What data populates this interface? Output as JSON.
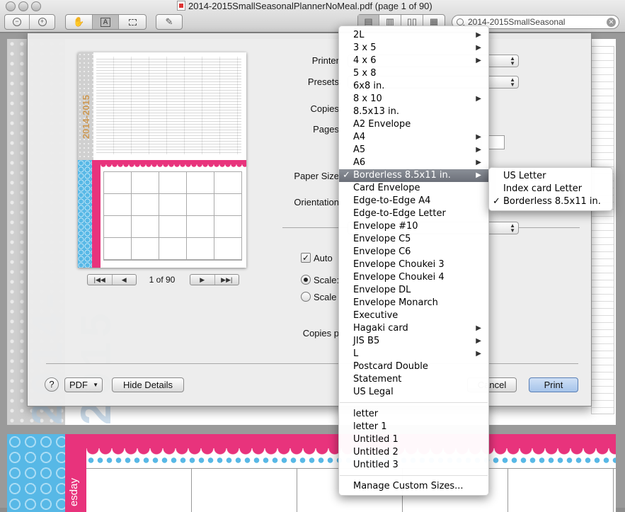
{
  "window": {
    "title": "2014-2015SmallSeasonalPlannerNoMeal.pdf (page 1 of 90)",
    "search_value": "2014-2015SmallSeasonal"
  },
  "background": {
    "page2_day": "esday",
    "big_year": "2014-2015"
  },
  "dialog": {
    "preview": {
      "year_text": "2014-2015",
      "page_counter": "1 of 90",
      "first_label": "|◀◀",
      "prev_label": "◀",
      "next_label": "▶",
      "last_label": "▶▶|"
    },
    "labels": {
      "printer": "Printer",
      "presets": "Presets",
      "copies": "Copies",
      "pages": "Pages",
      "paper_size": "Paper Size",
      "orientation": "Orientation",
      "auto": "Auto",
      "scale": "Scale:",
      "scale_to_fit": "Scale",
      "copies_per": "Copies p"
    },
    "buttons": {
      "help": "?",
      "pdf": "PDF",
      "hide_details": "Hide Details",
      "cancel": "Cancel",
      "print": "Print"
    }
  },
  "paper_menu": {
    "items": [
      {
        "label": "2L",
        "submenu": true
      },
      {
        "label": "3 x 5",
        "submenu": true
      },
      {
        "label": "4 x 6",
        "submenu": true
      },
      {
        "label": "5 x 8",
        "submenu": false
      },
      {
        "label": "6x8 in.",
        "submenu": false
      },
      {
        "label": "8 x 10",
        "submenu": true
      },
      {
        "label": "8.5x13 in.",
        "submenu": false
      },
      {
        "label": "A2 Envelope",
        "submenu": false
      },
      {
        "label": "A4",
        "submenu": true
      },
      {
        "label": "A5",
        "submenu": true
      },
      {
        "label": "A6",
        "submenu": true
      },
      {
        "label": "Borderless 8.5x11 in.",
        "submenu": true,
        "checked": true,
        "highlighted": true
      },
      {
        "label": "Card Envelope",
        "submenu": false
      },
      {
        "label": "Edge-to-Edge A4",
        "submenu": false
      },
      {
        "label": "Edge-to-Edge Letter",
        "submenu": false
      },
      {
        "label": "Envelope #10",
        "submenu": false
      },
      {
        "label": "Envelope C5",
        "submenu": false
      },
      {
        "label": "Envelope C6",
        "submenu": false
      },
      {
        "label": "Envelope Choukei 3",
        "submenu": false
      },
      {
        "label": "Envelope Choukei 4",
        "submenu": false
      },
      {
        "label": "Envelope DL",
        "submenu": false
      },
      {
        "label": "Envelope Monarch",
        "submenu": false
      },
      {
        "label": "Executive",
        "submenu": false
      },
      {
        "label": "Hagaki card",
        "submenu": true
      },
      {
        "label": "JIS B5",
        "submenu": true
      },
      {
        "label": "L",
        "submenu": true
      },
      {
        "label": "Postcard Double",
        "submenu": false
      },
      {
        "label": "Statement",
        "submenu": false
      },
      {
        "label": "US Legal",
        "submenu": false
      }
    ],
    "custom_items": [
      "letter",
      "letter 1",
      "Untitled 1",
      "Untitled 2",
      "Untitled 3"
    ],
    "manage": "Manage Custom Sizes..."
  },
  "sub_menu": {
    "items": [
      {
        "label": "US Letter",
        "checked": false
      },
      {
        "label": "Index card Letter",
        "checked": false
      },
      {
        "label": "Borderless 8.5x11 in.",
        "checked": true
      }
    ]
  },
  "checkmark": "✓",
  "submenu_arrow": "▶"
}
